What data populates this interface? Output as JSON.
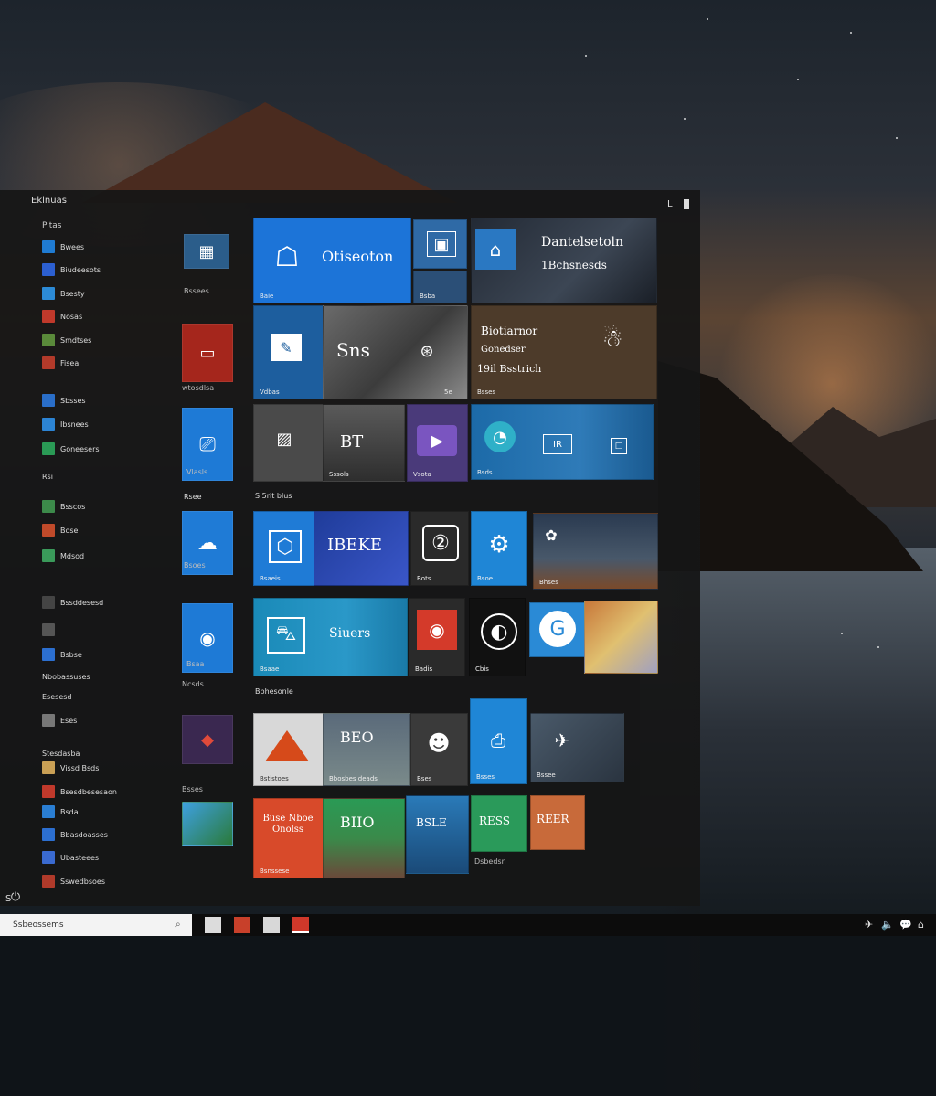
{
  "start_menu": {
    "header_title": "Eklnuas",
    "top_right_label": "L",
    "applist_header": "Pitas",
    "apps": [
      {
        "label": "Bwees",
        "color": "#1f7bd2"
      },
      {
        "label": "Biudeesots",
        "color": "#2c5fd0"
      },
      {
        "label": "Bsesty",
        "color": "#2c8ad6"
      },
      {
        "label": "Nosas",
        "color": "#c0392b"
      },
      {
        "label": "Smdtses",
        "color": "#5a8a3a"
      },
      {
        "label": "Fisea",
        "color": "#b23a2a"
      },
      {
        "label": "Sbsses",
        "color": "#2a6ec8"
      },
      {
        "label": "Ibsnees",
        "color": "#2c84d4"
      },
      {
        "label": "Goneesers",
        "color": "#2a9a55"
      },
      {
        "label": "Rsi",
        "color": "#555"
      },
      {
        "label": "Bsscos",
        "color": "#3c8a4a"
      },
      {
        "label": "Bose",
        "color": "#c04a2a"
      },
      {
        "label": "Mdsod",
        "color": "#3a9a5a"
      },
      {
        "label": "Bssddesesd",
        "color": "#444"
      },
      {
        "label": "",
        "color": "#555"
      },
      {
        "label": "Bsbse",
        "color": "#2c6fd0"
      },
      {
        "label": "Nbobassuses",
        "color": "#333"
      },
      {
        "label": "Esesesd",
        "color": "#444"
      },
      {
        "label": "Eses",
        "color": "#777"
      },
      {
        "label": "Stesdasba",
        "color": "#444"
      },
      {
        "label": "Vissd Bsds",
        "color": "#c9a055"
      },
      {
        "label": "Bsesdbesesaon",
        "color": "#c0392b"
      },
      {
        "label": "Bsda",
        "color": "#2a7ed2"
      },
      {
        "label": "Bbasdoasses",
        "color": "#2c6fd0"
      },
      {
        "label": "Ubasteees",
        "color": "#3a6ad0"
      },
      {
        "label": "Sswedbsoes",
        "color": "#b03a2a"
      }
    ],
    "section_labels": [
      "S 5rit blus",
      "Bbhesonle"
    ],
    "mid_labels": [
      "Bssees",
      "wtosdlsa",
      "Vlasls",
      "Rsee",
      "Bsoes",
      "Bsaa",
      "Ncsds",
      "Bsses"
    ],
    "tiles": {
      "t_office": {
        "title": "Otiseoton",
        "label": "Baie"
      },
      "t_small1": {
        "label": "Bsba"
      },
      "t_dark1": {
        "title": "Dantelsetoln",
        "sub": "1Bchsnesds",
        "label": ""
      },
      "t_sketch": {
        "title": "Sns",
        "label": "5e"
      },
      "t_blue1": {
        "label": "Vdbas"
      },
      "t_brown": {
        "line1": "Biotiarnor",
        "line2": "Gonedser",
        "line3": "19il Bsstrich",
        "label": "Bsses"
      },
      "t_gray1": {
        "label": ""
      },
      "t_street": {
        "title": "BT",
        "label": "Sssols"
      },
      "t_purple": {
        "label": "Vsota"
      },
      "t_sky": {
        "label": "Bsds"
      },
      "t_code": {
        "title": "IBEKE",
        "label": "Bsaeis"
      },
      "t_dark2": {
        "label": "Bots"
      },
      "t_blue2": {
        "label": "Bsoe"
      },
      "t_boat": {
        "label": "Bhses"
      },
      "t_store": {
        "title": "Siuers",
        "label": "Bsaae"
      },
      "t_red": {
        "label": "Badis"
      },
      "t_black": {
        "label": "Cbis"
      },
      "t_art": {
        "label": ""
      },
      "t_mountain": {
        "title": "",
        "label": "Bstistoes"
      },
      "t_people": {
        "title": "BEO",
        "label": "Bbosbes deads"
      },
      "t_rest": {
        "label": "Bses"
      },
      "t_blue3": {
        "label": "Bsses"
      },
      "t_bird": {
        "label": "Bssee"
      },
      "t_newsred": {
        "title": "Buse Nboe Onolss",
        "label": "Bsnssese"
      },
      "t_green": {
        "title": "BIIO",
        "label": ""
      },
      "t_lake": {
        "title": "BSLE",
        "label": ""
      },
      "t_greenb": {
        "title": "RESS",
        "label": "Dsbedsn"
      },
      "t_orange": {
        "title": "REER",
        "label": ""
      }
    }
  },
  "taskbar": {
    "search_text": "Ssbeossems",
    "start_glyph": "S",
    "tray": [
      "✈",
      "🔈",
      "💬",
      "⌂"
    ]
  }
}
